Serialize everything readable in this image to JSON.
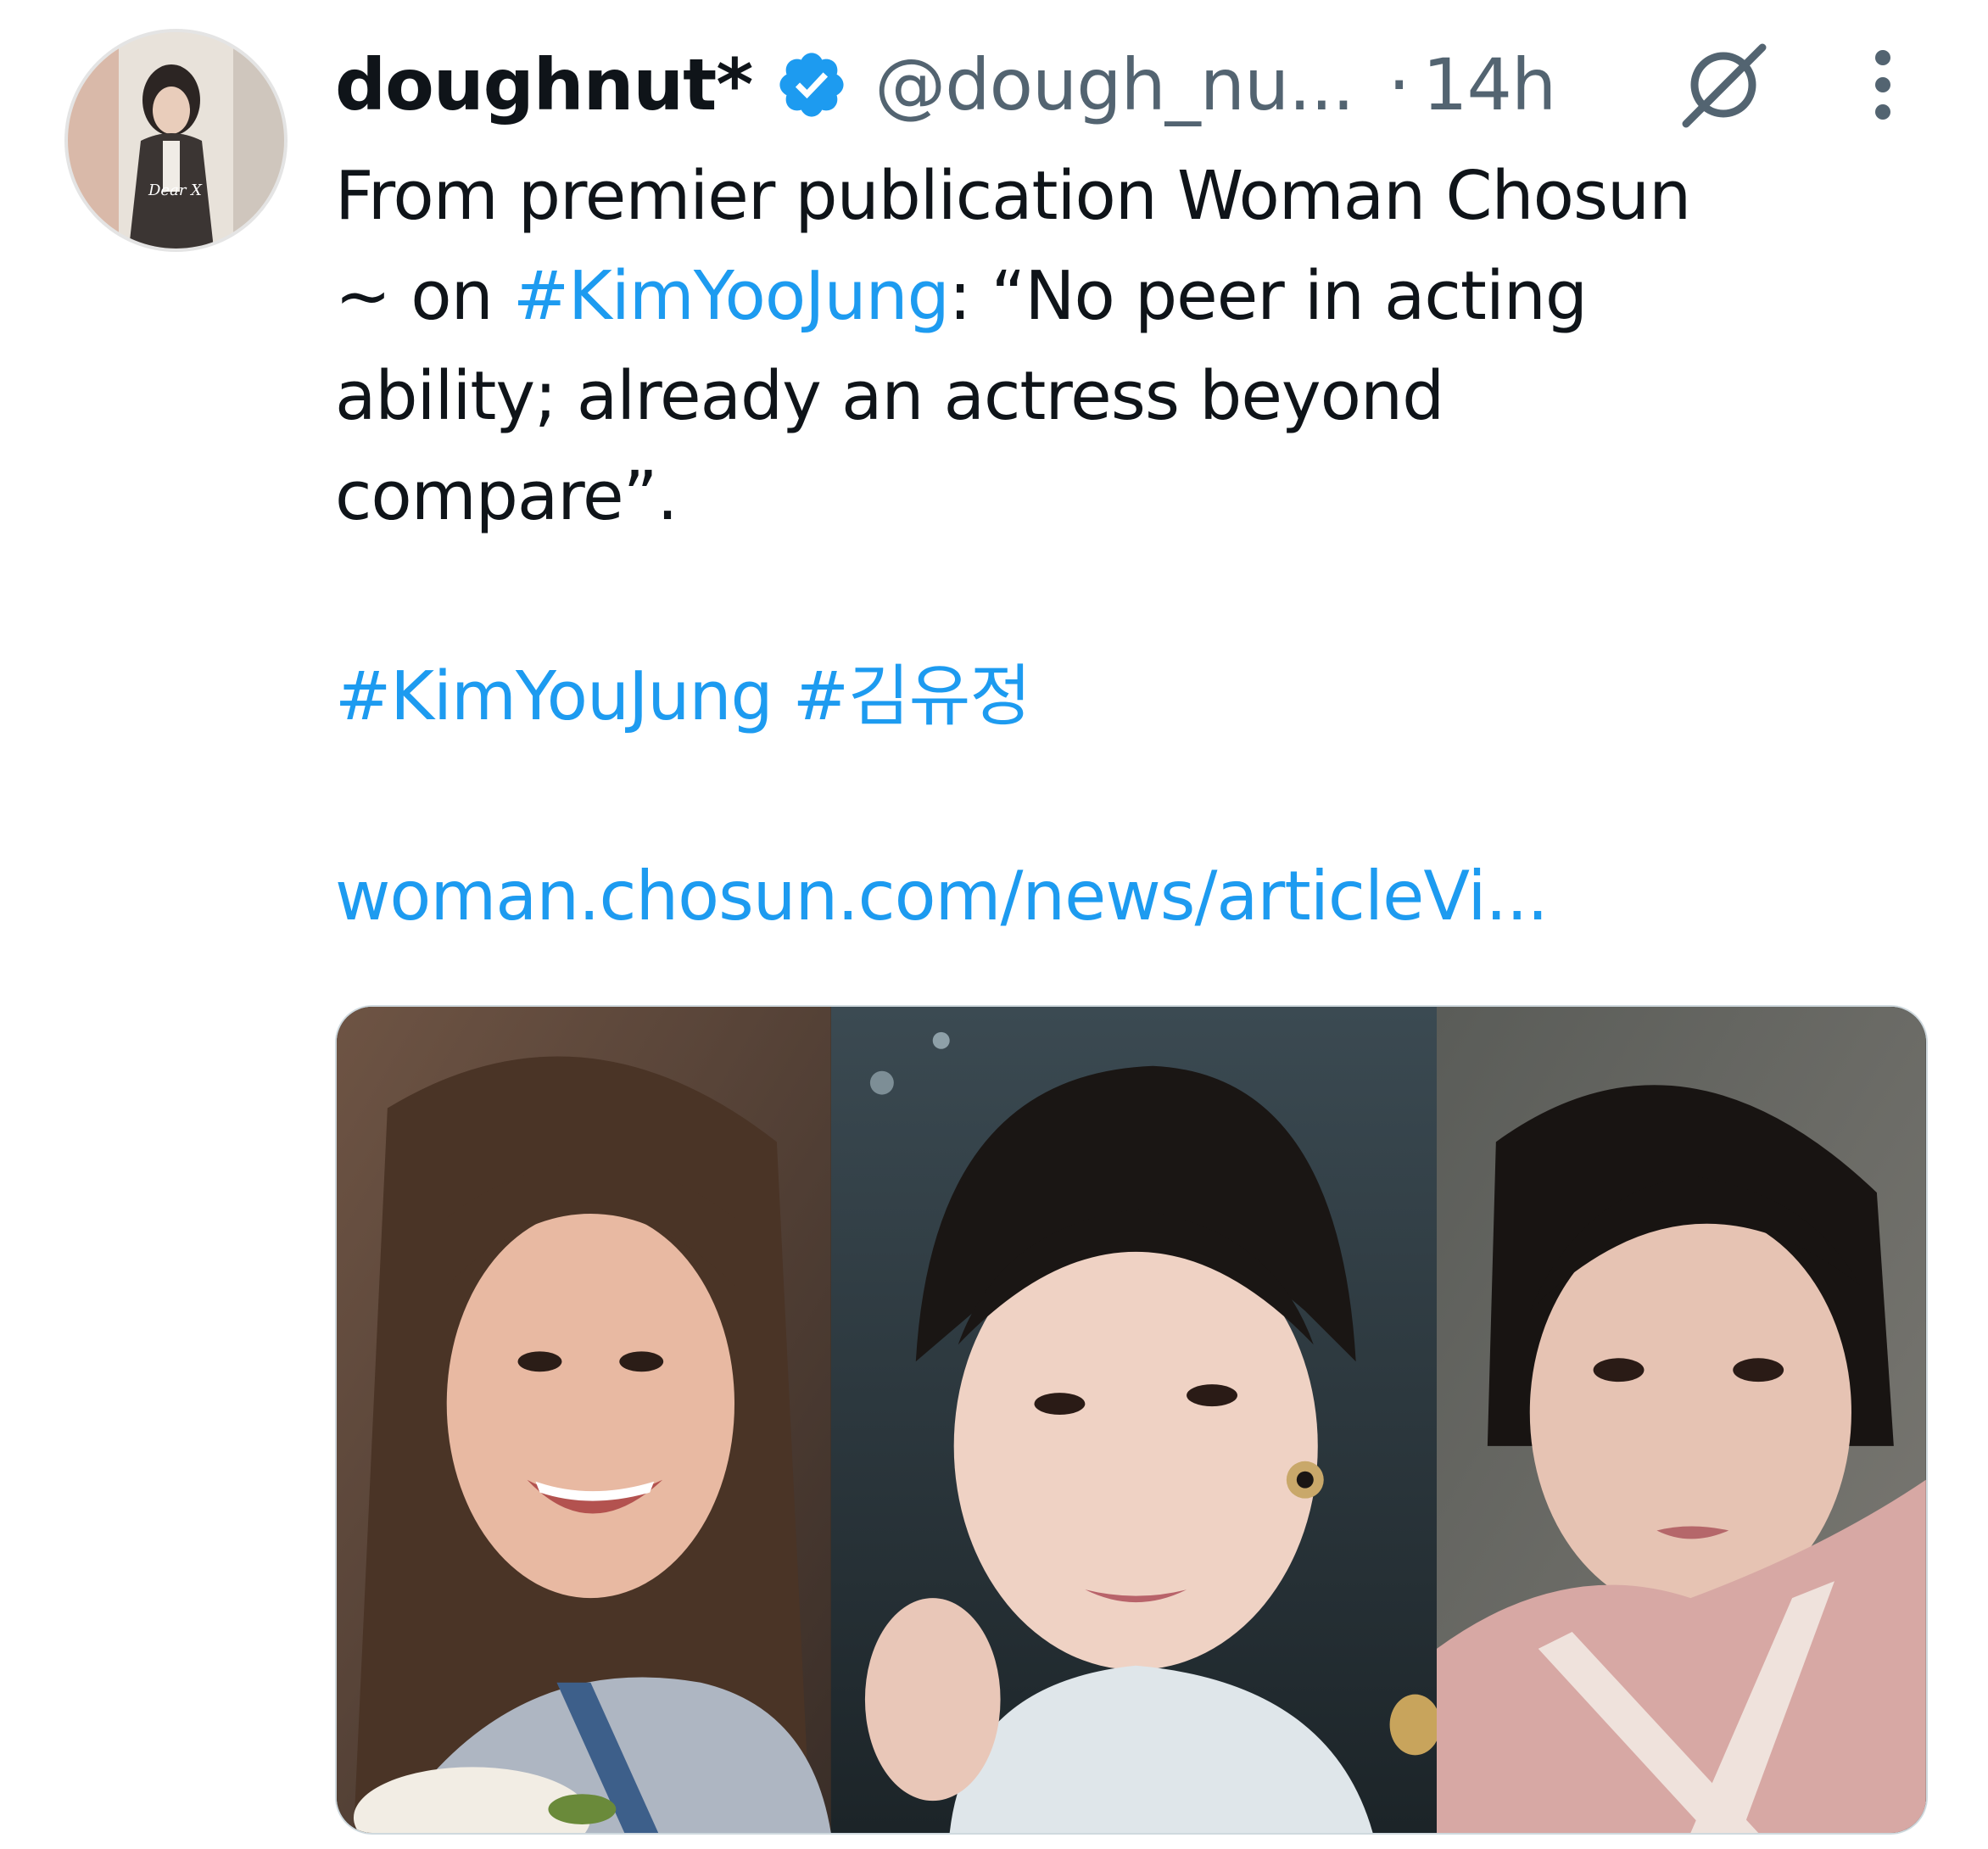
{
  "author": {
    "display_name": "doughnut*",
    "handle": "@dough_nu...",
    "separator": "·",
    "time": "14h",
    "verified_icon": "verified-badge-icon",
    "avatar_caption": "Dear X"
  },
  "actions": {
    "grok_icon": "grok-icon",
    "more_icon": "more-options-icon"
  },
  "tweet": {
    "line1": "From premier publication Woman Chosun",
    "line2_prefix": "~ on ",
    "hashtag1": "#KimYooJung",
    "line2_suffix": ": “No peer in acting",
    "line3": "ability; already an actress beyond",
    "line4": "compare”.",
    "hashtag2": "#KimYouJung",
    "hashtag3": "#김유정",
    "url": "woman.chosun.com/news/articleVi..."
  },
  "colors": {
    "text": "#0f1419",
    "secondary": "#536471",
    "link": "#1d9bf0",
    "verified": "#1d9bf0"
  },
  "media": {
    "count": 3
  }
}
